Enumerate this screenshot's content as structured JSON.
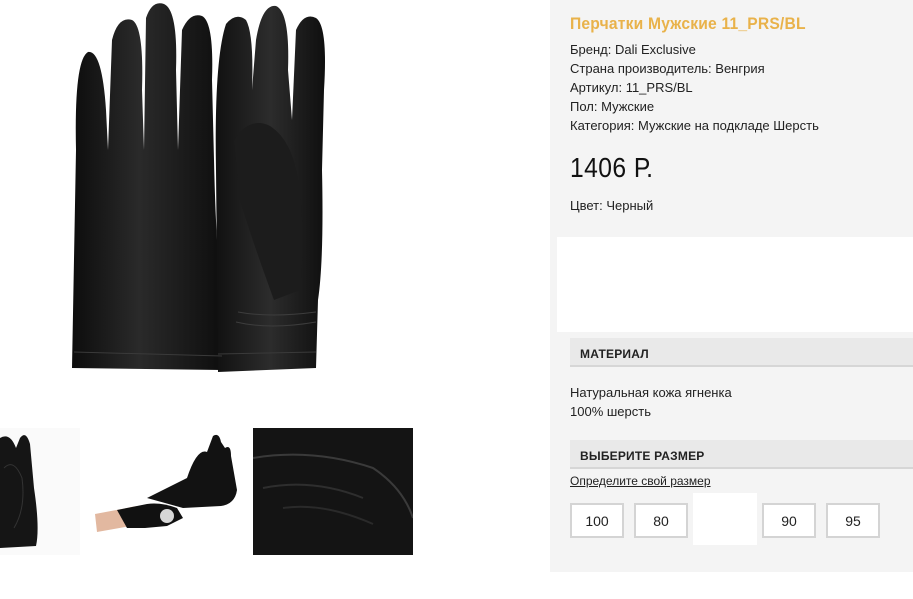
{
  "product": {
    "title": "Перчатки Мужские 11_PRS/BL",
    "brand": "Бренд: Dali Exclusive",
    "country": "Страна производитель: Венгрия",
    "sku": "Артикул: 11_PRS/BL",
    "gender": "Пол: Мужские",
    "category": "Категория: Мужские на подкладе Шерсть",
    "price": "1406 Р.",
    "color": "Цвет: Черный"
  },
  "material": {
    "heading": "МАТЕРИАЛ",
    "line1": "Натуральная кожа ягненка",
    "line2": "100% шерсть"
  },
  "size": {
    "heading": "ВЫБЕРИТЕ РАЗМЕР",
    "link": "Определите свой размер",
    "options": [
      "100",
      "80",
      "90",
      "95"
    ]
  },
  "colors": {
    "title": "#e9b24a",
    "panel_bg": "#f4f4f4",
    "section_bg": "#e9e9e9"
  }
}
